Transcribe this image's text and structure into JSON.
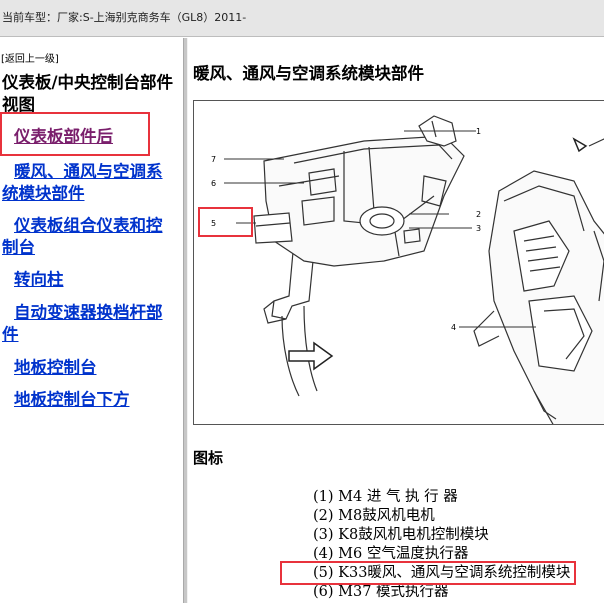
{
  "header": {
    "vehicle_label": "当前车型：",
    "vehicle_value": "厂家:S-上海别克商务车（GL8）2011-"
  },
  "back_link": "[返回上一级]",
  "sidebar": {
    "title": "仪表板/中央控制台部件视图",
    "items": [
      {
        "label": "仪表板部件后"
      },
      {
        "label": "暖风、通风与空调系统模块部件"
      },
      {
        "label": "仪表板组合仪表和控制台"
      },
      {
        "label": "转向柱"
      },
      {
        "label": "自动变速器换档杆部件"
      },
      {
        "label": "地板控制台"
      },
      {
        "label": "地板控制台下方"
      }
    ]
  },
  "main": {
    "title": "暖风、通风与空调系统模块部件",
    "figure_callouts": [
      "1",
      "2",
      "3",
      "4",
      "5",
      "6",
      "7"
    ],
    "legend_title": "图标",
    "legend": [
      "(1) M4 进 气 执 行 器",
      "(2) M8鼓风机电机",
      "(3) K8鼓风机电机控制模块",
      "(4) M6 空气温度执行器",
      "(5) K33暖风、通风与空调系统控制模块",
      "(6) M37 模式执行器"
    ]
  },
  "colors": {
    "link": "#0033cc",
    "visited_link": "#7a1f6c",
    "highlight_box": "#e8323c",
    "header_bg": "#e6e6e6"
  }
}
